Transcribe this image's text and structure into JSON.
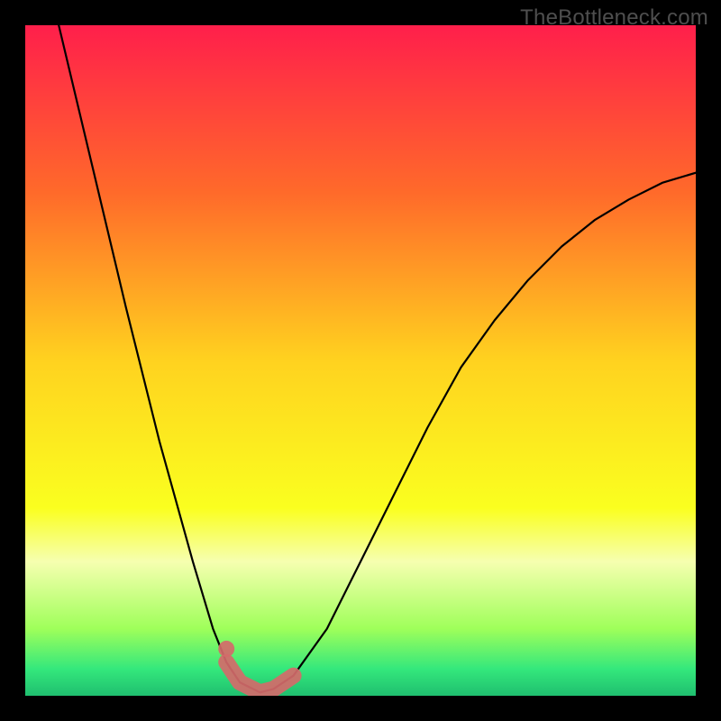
{
  "watermark": "TheBottleneck.com",
  "chart_data": {
    "type": "line",
    "title": "",
    "xlabel": "",
    "ylabel": "",
    "xlim": [
      0,
      100
    ],
    "ylim": [
      0,
      100
    ],
    "series": [
      {
        "name": "curve",
        "x": [
          5,
          10,
          15,
          20,
          25,
          28,
          30,
          32,
          34,
          35,
          37,
          40,
          45,
          50,
          55,
          60,
          65,
          70,
          75,
          80,
          85,
          90,
          95,
          100
        ],
        "values": [
          100,
          79,
          58,
          38,
          20,
          10,
          5,
          2,
          1,
          0.5,
          1,
          3,
          10,
          20,
          30,
          40,
          49,
          56,
          62,
          67,
          71,
          74,
          76.5,
          78
        ]
      },
      {
        "name": "highlight",
        "x": [
          30,
          32,
          34,
          35,
          37,
          40
        ],
        "values": [
          5,
          2,
          1,
          0.5,
          1,
          3
        ]
      }
    ],
    "highlight_dot": {
      "x": 30,
      "y": 7
    },
    "background_gradient": {
      "stops": [
        {
          "offset": 0,
          "color": "#ff1f4b"
        },
        {
          "offset": 0.25,
          "color": "#ff6a2a"
        },
        {
          "offset": 0.5,
          "color": "#ffd21f"
        },
        {
          "offset": 0.72,
          "color": "#faff1f"
        },
        {
          "offset": 0.8,
          "color": "#f6ffb0"
        },
        {
          "offset": 0.9,
          "color": "#9fff5a"
        },
        {
          "offset": 0.96,
          "color": "#34e87c"
        },
        {
          "offset": 1.0,
          "color": "#1fbf6f"
        }
      ]
    },
    "colors": {
      "curve": "#000000",
      "highlight": "#d46a6a",
      "highlight_dot": "#d46a6a"
    }
  }
}
